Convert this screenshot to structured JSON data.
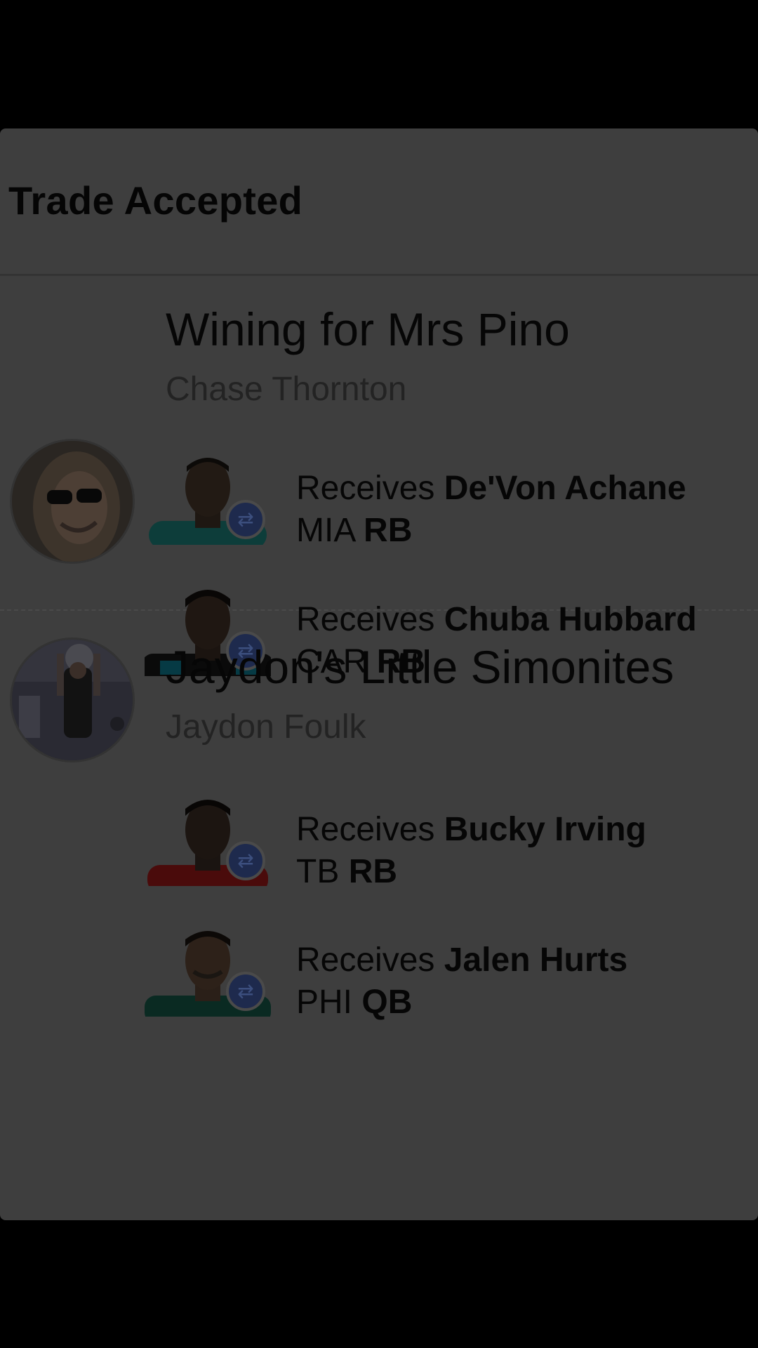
{
  "card": {
    "title": "Trade Accepted"
  },
  "teams": [
    {
      "team_name": "Wining for Mrs Pino",
      "owner": "Chase Thornton",
      "players": [
        {
          "receives_label": "Receives",
          "name": "De'Von Achane",
          "team": "MIA",
          "position": "RB",
          "jersey_color": "#0d3d3a"
        },
        {
          "receives_label": "Receives",
          "name": "Chuba Hubbard",
          "team": "CAR",
          "position": "RB",
          "jersey_color": "#0a0a0a"
        }
      ]
    },
    {
      "team_name": "Jaydon's Little Simonites",
      "owner": "Jaydon Foulk",
      "players": [
        {
          "receives_label": "Receives",
          "name": "Bucky Irving",
          "team": "TB",
          "position": "RB",
          "jersey_color": "#4a0b0b"
        },
        {
          "receives_label": "Receives",
          "name": "Jalen Hurts",
          "team": "PHI",
          "position": "QB",
          "jersey_color": "#0a2a22"
        }
      ]
    }
  ],
  "icons": {
    "swap": "swap-arrows-icon",
    "swap_glyph": "⇄"
  }
}
